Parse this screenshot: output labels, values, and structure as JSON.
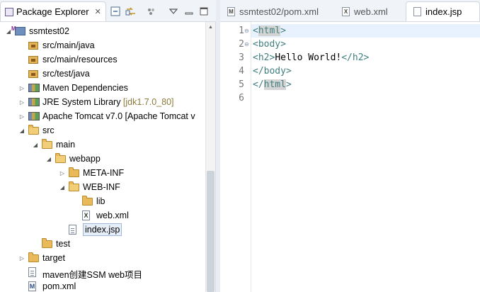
{
  "package_explorer": {
    "title": "Package Explorer",
    "close": "✕",
    "toolbar": [
      "collapse-all-icon",
      "link-with-editor-icon",
      "view-menu-dots-icon",
      "view-menu-chevron-icon",
      "minimize-icon",
      "maximize-icon"
    ],
    "tree": [
      {
        "label": "ssmtest02",
        "depth": 0,
        "arrow": "open",
        "icon": "project-icon"
      },
      {
        "label": "src/main/java",
        "depth": 1,
        "arrow": "none",
        "icon": "source-folder-icon"
      },
      {
        "label": "src/main/resources",
        "depth": 1,
        "arrow": "none",
        "icon": "source-folder-icon"
      },
      {
        "label": "src/test/java",
        "depth": 1,
        "arrow": "none",
        "icon": "source-folder-icon"
      },
      {
        "label": "Maven Dependencies",
        "depth": 1,
        "arrow": "closed",
        "icon": "library-icon"
      },
      {
        "label": "JRE System Library",
        "extra": "[jdk1.7.0_80]",
        "depth": 1,
        "arrow": "closed",
        "icon": "library-icon"
      },
      {
        "label": "Apache Tomcat v7.0 [Apache Tomcat v",
        "depth": 1,
        "arrow": "closed",
        "icon": "library-icon"
      },
      {
        "label": "src",
        "depth": 1,
        "arrow": "open",
        "icon": "folder-open-icon"
      },
      {
        "label": "main",
        "depth": 2,
        "arrow": "open",
        "icon": "folder-open-icon"
      },
      {
        "label": "webapp",
        "depth": 3,
        "arrow": "open",
        "icon": "folder-open-icon"
      },
      {
        "label": "META-INF",
        "depth": 4,
        "arrow": "closed",
        "icon": "folder-icon"
      },
      {
        "label": "WEB-INF",
        "depth": 4,
        "arrow": "open",
        "icon": "folder-open-icon"
      },
      {
        "label": "lib",
        "depth": 5,
        "arrow": "none",
        "icon": "folder-icon"
      },
      {
        "label": "web.xml",
        "depth": 5,
        "arrow": "none",
        "icon": "xml-file-icon"
      },
      {
        "label": "index.jsp",
        "depth": 4,
        "arrow": "none",
        "icon": "jsp-file-icon",
        "selected": true
      },
      {
        "label": "test",
        "depth": 2,
        "arrow": "none",
        "icon": "folder-icon"
      },
      {
        "label": "target",
        "depth": 1,
        "arrow": "closed",
        "icon": "folder-icon"
      },
      {
        "label": "maven创建SSM web项目",
        "depth": 1,
        "arrow": "none",
        "icon": "text-file-icon"
      },
      {
        "label": "pom.xml",
        "depth": 1,
        "arrow": "none",
        "icon": "maven-pom-icon"
      }
    ]
  },
  "editor": {
    "tabs": [
      {
        "label": "ssmtest02/pom.xml",
        "icon": "maven-pom-icon",
        "glyph": "M",
        "active": false
      },
      {
        "label": "web.xml",
        "icon": "xml-file-icon",
        "glyph": "X",
        "active": false
      },
      {
        "label": "index.jsp",
        "icon": "jsp-file-icon",
        "glyph": "",
        "active": true
      }
    ],
    "lines": [
      {
        "num": "1",
        "fold": "⊖",
        "open": "<",
        "name": "html",
        "close": ">",
        "highlight_name": true
      },
      {
        "num": "2",
        "fold": "⊖",
        "open": "<",
        "name": "body",
        "close": ">"
      },
      {
        "num": "3",
        "fold": "",
        "open": "<",
        "name": "h2",
        "close": ">",
        "text": "Hello World!",
        "end_open": "</",
        "end_name": "h2",
        "end_close": ">"
      },
      {
        "num": "4",
        "fold": "",
        "open": "</",
        "name": "body",
        "close": ">"
      },
      {
        "num": "5",
        "fold": "",
        "open": "</",
        "name": "html",
        "close": ">",
        "highlight_name": true
      },
      {
        "num": "6",
        "fold": "",
        "open": "",
        "name": "",
        "close": ""
      }
    ],
    "current_line": 1
  },
  "colors": {
    "tag": "#3f7f7f",
    "selection": "#e6eef9",
    "current_line": "#e8f2fe"
  }
}
